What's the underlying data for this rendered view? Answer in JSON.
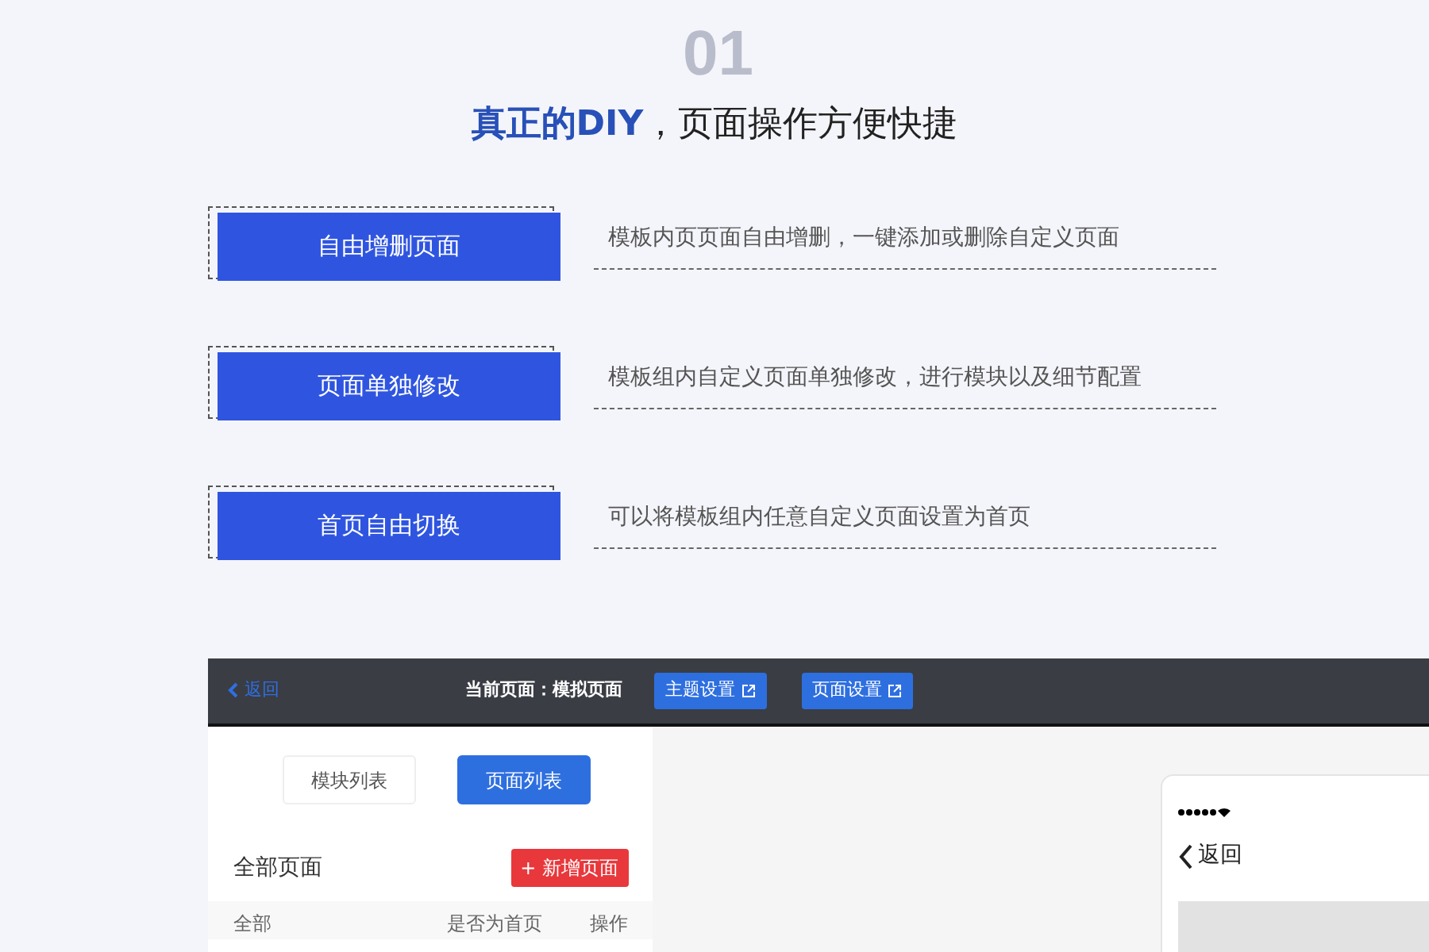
{
  "heading": {
    "highlight": "真正的DIY",
    "rest": "，页面操作方便快捷",
    "number": "01"
  },
  "features": [
    {
      "label": "自由增删页面",
      "description": "模板内页页面自由增删，一键添加或删除自定义页面"
    },
    {
      "label": "页面单独修改",
      "description": "模板组内自定义页面单独修改，进行模块以及细节配置"
    },
    {
      "label": "首页自由切换",
      "description": "可以将模板组内任意自定义页面设置为首页"
    }
  ],
  "app": {
    "toolbar": {
      "back": "返回",
      "current_page": "当前页面：模拟页面",
      "buttons": [
        "主题设置",
        "页面设置"
      ]
    },
    "tabs": [
      {
        "label": "模块列表",
        "selected": false
      },
      {
        "label": "页面列表",
        "selected": true
      }
    ],
    "section_title": "全部页面",
    "add_button": {
      "icon": "+",
      "label": "新增页面"
    },
    "table": {
      "columns": [
        "全部",
        "是否为首页",
        "操作"
      ]
    },
    "phone": {
      "back": "返回"
    }
  }
}
